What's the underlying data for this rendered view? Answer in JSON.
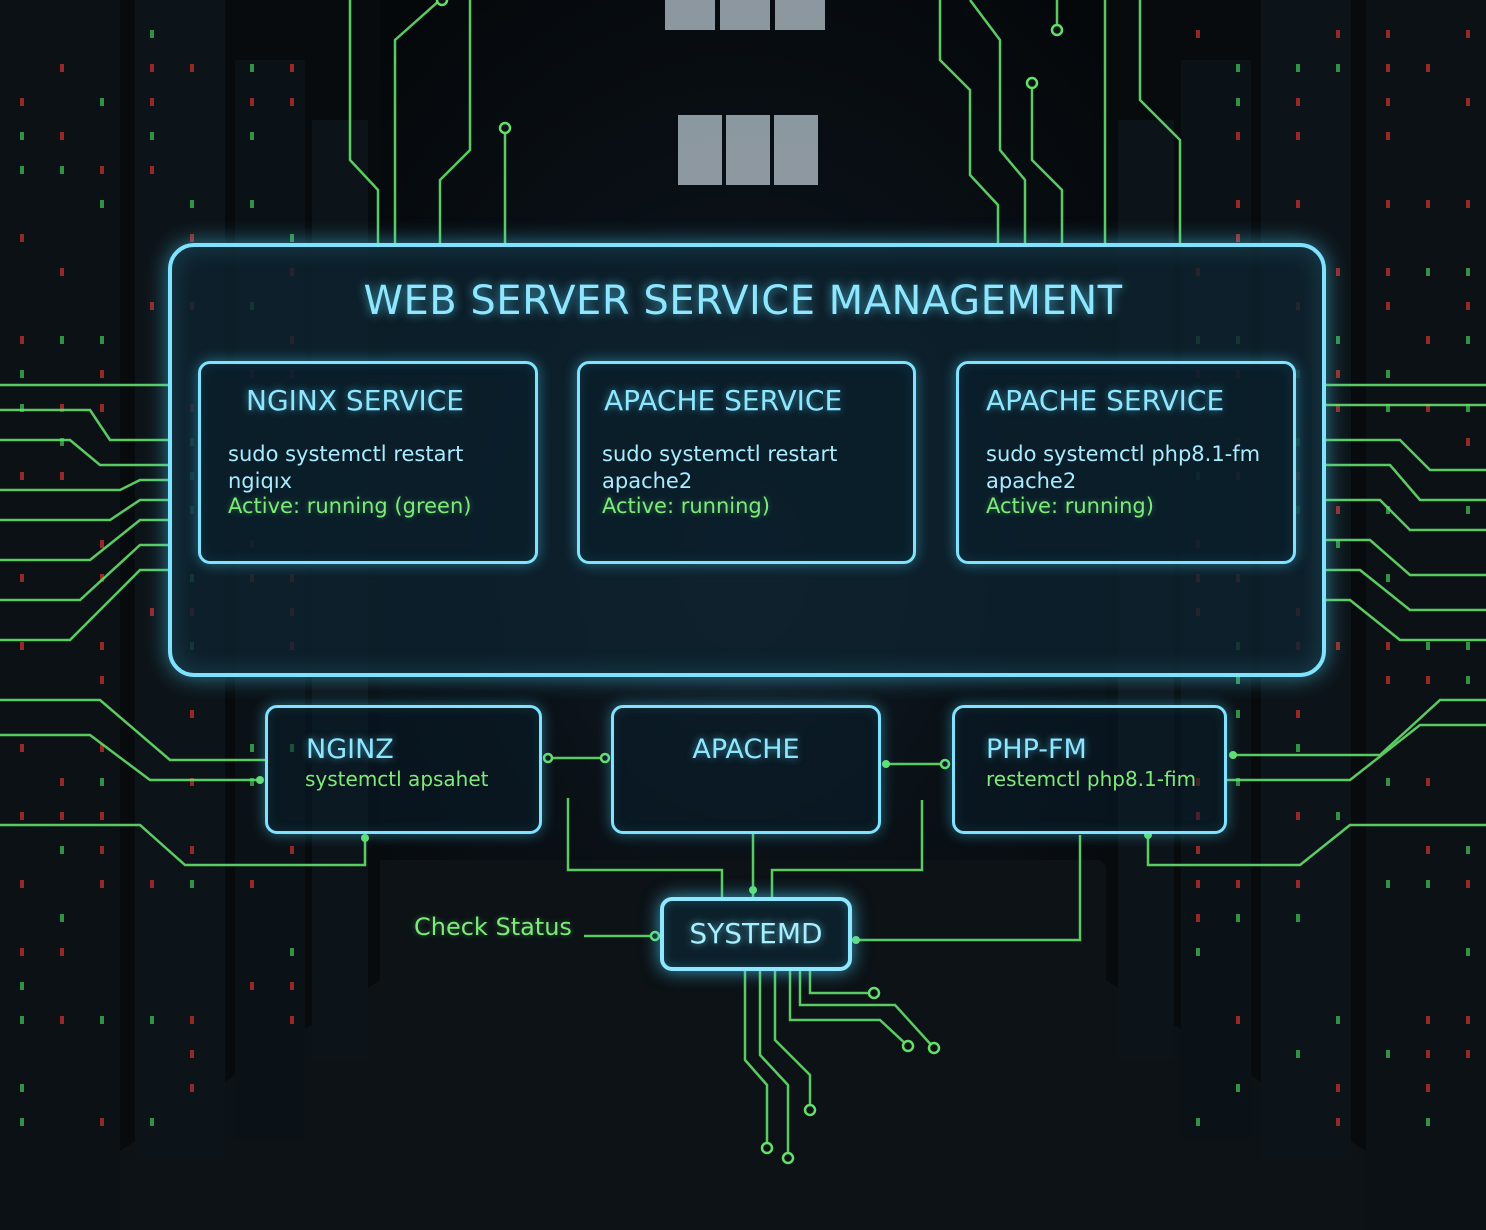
{
  "colors": {
    "panel_border": "#7fe3ff",
    "title_text": "#8fe6ff",
    "status_green": "#7dea7a",
    "wire_green": "#62e06a",
    "background": "#05080b"
  },
  "diagram": {
    "title": "WEB SERVER SERVICE MANAGEMENT",
    "services": [
      {
        "title": "NGINX SERVICE",
        "cmd_line1": "sudo systemctl  restart",
        "cmd_line2": "ngiqıx",
        "status": "Active: running (green)"
      },
      {
        "title": "APACHE SERVICE",
        "cmd_line1": "sudo systemctl  restart",
        "cmd_line2": "apache2",
        "status": "Active: running)"
      },
      {
        "title": "APACHE SERVICE",
        "cmd_line1": "sudo systemctl  php8.1-fm",
        "cmd_line2": "apache2",
        "status": "Active: running)"
      }
    ],
    "nodes": [
      {
        "title": "NGINZ",
        "cmd": "systemctl  apsahet"
      },
      {
        "title": "APACHE",
        "cmd": ""
      },
      {
        "title": "PHP-FM",
        "cmd": "restemctl  php8.1-fim"
      }
    ],
    "systemd_label": "SYSTEMD",
    "check_status_label": "Check Status"
  }
}
